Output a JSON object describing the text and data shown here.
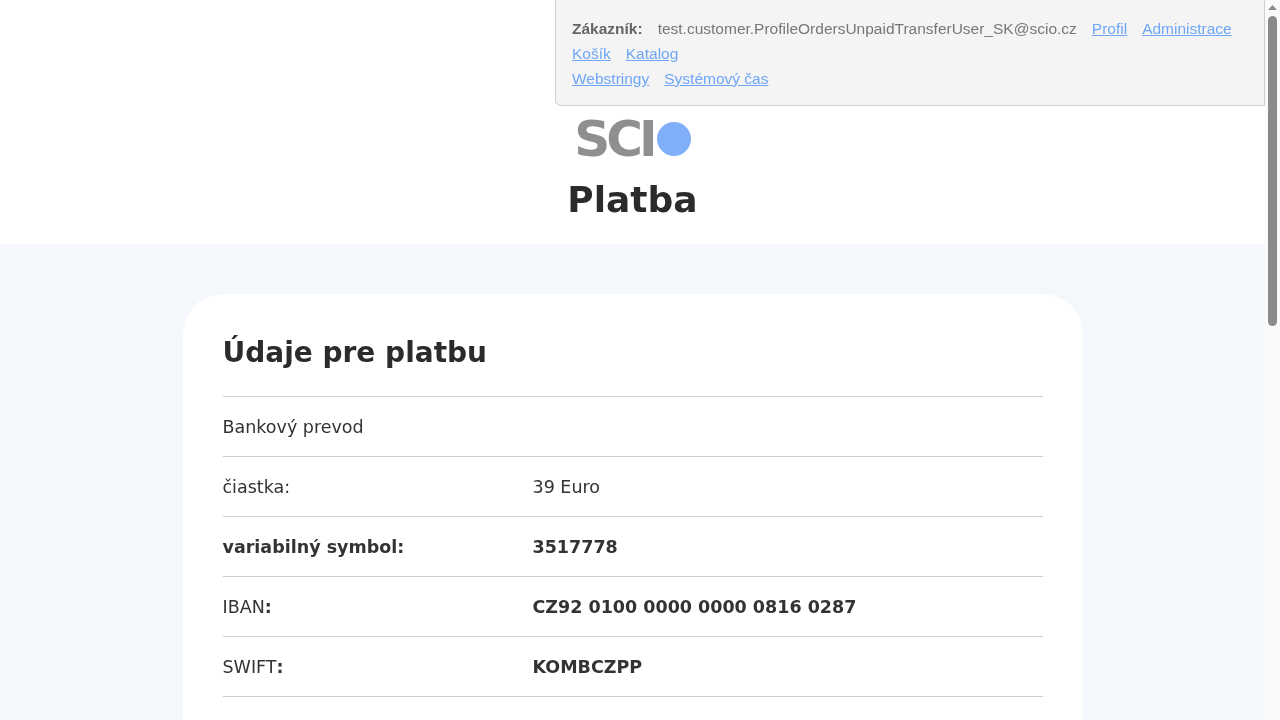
{
  "admin_panel": {
    "customer_label": "Zákazník:",
    "customer_email": "test.customer.ProfileOrdersUnpaidTransferUser_SK@scio.cz",
    "link_lines": [
      [
        "Profil",
        "Administrace"
      ],
      [
        "Košík",
        "Katalog"
      ],
      [
        "Webstringy",
        "Systémový čas"
      ]
    ]
  },
  "logo": {
    "text": "SCI"
  },
  "page_title": "Platba",
  "payment_card": {
    "heading": "Údaje pre platbu",
    "rows": [
      {
        "label": "Bankový prevod",
        "label_bold": false
      },
      {
        "label": "čiastka:",
        "label_bold": false,
        "value": "39 Euro",
        "value_bold": false
      },
      {
        "label": "variabilný symbol:",
        "label_bold": true,
        "value": "3517778",
        "value_bold": true
      },
      {
        "label": "IBAN**:**",
        "label_bold": false,
        "value": "CZ92 0100 0000 0000 0816 0287",
        "value_bold": true
      },
      {
        "label": "SWIFT**:**",
        "label_bold": false,
        "value": "KOMBCZPP",
        "value_bold": true
      }
    ]
  }
}
